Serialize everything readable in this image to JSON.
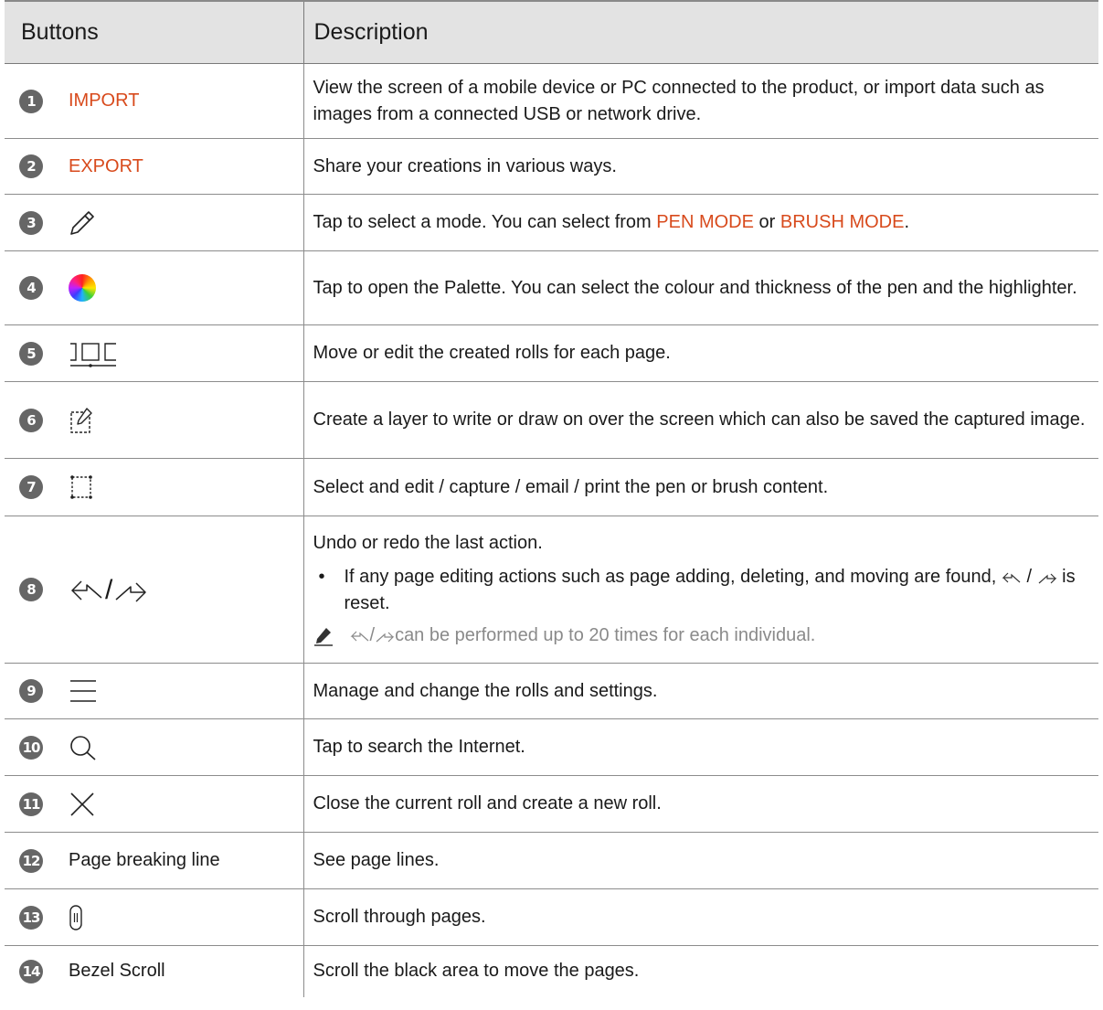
{
  "header": {
    "col1": "Buttons",
    "col2": "Description"
  },
  "rows": [
    {
      "num": "1",
      "label": "IMPORT",
      "desc": "View the screen of a mobile device or PC connected to the product, or import data such as images from a connected USB or network drive."
    },
    {
      "num": "2",
      "label": "EXPORT",
      "desc": "Share your creations in various ways."
    },
    {
      "num": "3",
      "icon": "pen-icon",
      "desc_a": "Tap to select a mode. You can select from ",
      "pen_mode": "PEN MODE",
      "desc_or": " or ",
      "brush_mode": "BRUSH MODE",
      "desc_end": "."
    },
    {
      "num": "4",
      "icon": "palette-color-wheel-icon",
      "desc": "Tap to open the Palette. You can select the colour and thickness of the pen and the highlighter."
    },
    {
      "num": "5",
      "icon": "page-rolls-icon",
      "desc": "Move or edit the created rolls for each page."
    },
    {
      "num": "6",
      "icon": "capture-layer-icon",
      "desc": "Create a layer to write or draw on over the screen which can also be saved the captured image."
    },
    {
      "num": "7",
      "icon": "select-area-icon",
      "desc": "Select and edit / capture / email / print the pen or brush content."
    },
    {
      "num": "8",
      "icon": "undo-redo-icon",
      "sep": "/",
      "desc": "Undo or redo the last action.",
      "bullet_a": "If any page editing actions such as page adding, deleting, and moving are found, ",
      "bullet_sep": " / ",
      "bullet_b": " is reset.",
      "note_sep": " / ",
      "note_b": " can be performed up to 20 times for each individual."
    },
    {
      "num": "9",
      "icon": "menu-icon",
      "desc": "Manage and change the rolls and settings."
    },
    {
      "num": "10",
      "icon": "search-icon",
      "desc": "Tap to search the Internet."
    },
    {
      "num": "11",
      "icon": "close-icon",
      "desc": "Close the current roll and create a new roll."
    },
    {
      "num": "12",
      "label": "Page breaking line",
      "desc": "See page lines."
    },
    {
      "num": "13",
      "icon": "scroll-handle-icon",
      "desc": "Scroll through pages."
    },
    {
      "num": "14",
      "label": "Bezel Scroll",
      "desc": "Scroll the black area to move the pages."
    }
  ],
  "colors": {
    "accent": "#d84a1c",
    "badge": "#666666",
    "header_bg": "#e3e3e3",
    "note_text": "#8a8a8a"
  }
}
